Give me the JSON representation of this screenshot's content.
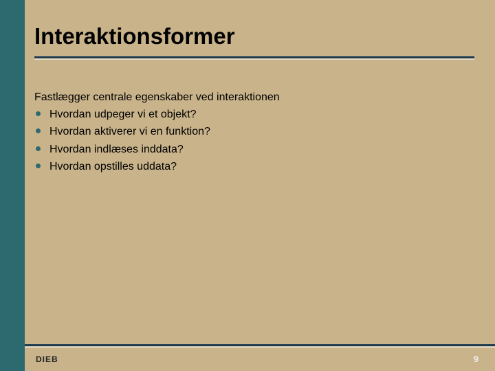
{
  "slide": {
    "title": "Interaktionsformer",
    "intro": "Fastlægger centrale egenskaber ved interaktionen",
    "bullets": [
      "Hvordan udpeger vi et objekt?",
      "Hvordan aktiverer vi en funktion?",
      "Hvordan indlæses inddata?",
      "Hvordan opstilles uddata?"
    ],
    "footer_left": "DIEB",
    "page_number": "9"
  }
}
